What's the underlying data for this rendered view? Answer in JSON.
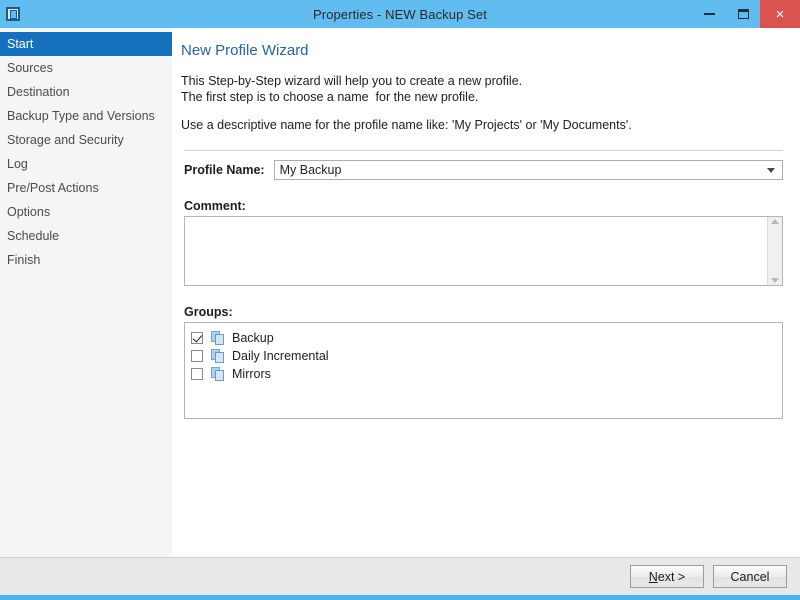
{
  "window": {
    "title": "Properties - NEW Backup Set",
    "icon": "app-window-icon",
    "controls": {
      "minimize": "minimize-icon",
      "maximize": "maximize-icon",
      "close": "×"
    },
    "accent_color": "#61bdf0",
    "close_color": "#d9534f"
  },
  "sidebar": {
    "items": [
      {
        "label": "Start",
        "selected": true
      },
      {
        "label": "Sources",
        "selected": false
      },
      {
        "label": "Destination",
        "selected": false
      },
      {
        "label": "Backup Type and Versions",
        "selected": false
      },
      {
        "label": "Storage and Security",
        "selected": false
      },
      {
        "label": "Log",
        "selected": false
      },
      {
        "label": "Pre/Post Actions",
        "selected": false
      },
      {
        "label": "Options",
        "selected": false
      },
      {
        "label": "Schedule",
        "selected": false
      },
      {
        "label": "Finish",
        "selected": false
      }
    ],
    "selected_color": "#1570bd"
  },
  "content": {
    "heading": "New Profile Wizard",
    "heading_color": "#2663a8",
    "intro_line1": "This Step-by-Step wizard will help you to create a new profile.",
    "intro_line2": "The first step is to choose a name  for the new profile.",
    "intro_line3": "Use a descriptive name for the profile name like: 'My Projects' or 'My Documents'.",
    "profile": {
      "label": "Profile Name:",
      "value": "My Backup",
      "arrow_icon": "chevron-down-icon"
    },
    "comment": {
      "label": "Comment:",
      "value": "",
      "scroll_up_icon": "scroll-up-arrow-icon",
      "scroll_down_icon": "scroll-down-arrow-icon"
    },
    "groups": {
      "label": "Groups:",
      "items": [
        {
          "label": "Backup",
          "checked": true,
          "icon": "pages-stack-icon"
        },
        {
          "label": "Daily Incremental",
          "checked": false,
          "icon": "pages-stack-icon"
        },
        {
          "label": "Mirrors",
          "checked": false,
          "icon": "pages-stack-icon"
        }
      ]
    }
  },
  "footer": {
    "next_accel": "N",
    "next_rest": "ext >",
    "cancel_label": "Cancel"
  }
}
